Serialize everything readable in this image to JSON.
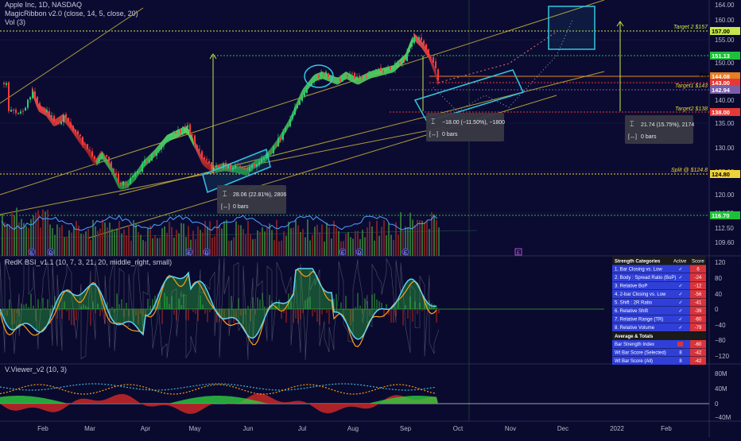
{
  "header": {
    "symbol": "Apple Inc, 1D, NASDAQ",
    "magic_ribbon": "MagicRibbon v2.0 (close, 14, 5, close, 20)",
    "vol": "Vol (3)"
  },
  "panes": {
    "bsi_title": "RedK BSI_v1.1 (10, 7, 3, 21, 20, middle_right, small)",
    "vviewer_title": "V.Viewer_v2 (10, 3)"
  },
  "chart_data": {
    "type": "line",
    "title": "Apple Inc, 1D, NASDAQ",
    "x_ticks": [
      "Feb",
      "Mar",
      "Apr",
      "May",
      "Jun",
      "Jul",
      "Aug",
      "Sep",
      "Oct",
      "Nov",
      "Dec",
      "2022",
      "Feb"
    ],
    "price_axis": [
      "164.00",
      "160.00",
      "155.00",
      "150.00",
      "145.00",
      "140.00",
      "135.00",
      "130.00",
      "125.00",
      "120.00",
      "114.50",
      "112.50",
      "109.60"
    ],
    "price_close_approx": [
      {
        "x": "Jan 26",
        "y": 141
      },
      {
        "x": "Feb 01",
        "y": 136
      },
      {
        "x": "Feb 15",
        "y": 133
      },
      {
        "x": "Mar 01",
        "y": 125
      },
      {
        "x": "Mar 15",
        "y": 121
      },
      {
        "x": "Apr 01",
        "y": 123
      },
      {
        "x": "Apr 15",
        "y": 133
      },
      {
        "x": "May 01",
        "y": 133
      },
      {
        "x": "May 15",
        "y": 126
      },
      {
        "x": "Jun 01",
        "y": 125
      },
      {
        "x": "Jun 15",
        "y": 129
      },
      {
        "x": "Jul 01",
        "y": 137
      },
      {
        "x": "Jul 15",
        "y": 147
      },
      {
        "x": "Aug 01",
        "y": 146
      },
      {
        "x": "Aug 15",
        "y": 148
      },
      {
        "x": "Sep 01",
        "y": 153
      },
      {
        "x": "Sep 07",
        "y": 157
      },
      {
        "x": "Sep 15",
        "y": 148
      },
      {
        "x": "Sep 20",
        "y": 144
      }
    ],
    "price_levels": {
      "target2": {
        "label": "Target 2 $157",
        "tag": "157.00",
        "color": "#c8e64b"
      },
      "resistance": {
        "tag": "151.13",
        "color": "#1fbf3a"
      },
      "pre": {
        "label": "Pre",
        "tag": "144.08",
        "color": "#e67e22"
      },
      "current": {
        "tag": "143.00",
        "color": "#e53935"
      },
      "target1": {
        "label": "Target1 $143",
        "tag": "142.94",
        "color": "#7b5ea7"
      },
      "target2_low": {
        "label": "Target2 $138",
        "tag": "138.00",
        "color": "#e53935"
      },
      "split": {
        "label": "Split @ $124.8",
        "tag": "124.80",
        "color": "#f0d33a"
      },
      "volume_ma": {
        "tag": "116.70",
        "color": "#1fbf3a"
      }
    },
    "measure_labels": [
      {
        "value": "28.06 (22.81%), 2806",
        "bars": "0 bars"
      },
      {
        "value": "−18.00 (−11.50%), −1800",
        "bars": "0 bars"
      },
      {
        "value": "21.74 (15.75%), 2174",
        "bars": "0 bars"
      }
    ],
    "event_markers": [
      "E",
      "D",
      "E",
      "D",
      "E",
      "D",
      "E"
    ],
    "earnings_marker": "E",
    "bsi_axis": [
      "120",
      "80",
      "40",
      "0",
      "−40",
      "−80",
      "−120"
    ],
    "vv_axis": [
      "80M",
      "40M",
      "0",
      "−40M"
    ],
    "strength_table": {
      "header": [
        "Strength Categories",
        "Active",
        "Score"
      ],
      "rows": [
        {
          "name": "1. Bar Closing vs. Low",
          "active": "✓",
          "score": "6"
        },
        {
          "name": "2. Body : Spread Ratio (BoP)",
          "active": "✓",
          "score": "-24"
        },
        {
          "name": "3. Relative BoP",
          "active": "✓",
          "score": "-12"
        },
        {
          "name": "4. 2-bar Closing vs. Low",
          "active": "✓",
          "score": "-56"
        },
        {
          "name": "5. Shift : 2R Ratio",
          "active": "✓",
          "score": "-41"
        },
        {
          "name": "6. Relative Shift",
          "active": "✓",
          "score": "-39"
        },
        {
          "name": "7. Relative Range (TR)",
          "active": "✓",
          "score": "-60"
        },
        {
          "name": "8. Relative Volume",
          "active": "✓",
          "score": "-79"
        }
      ],
      "section": "Average & Totals",
      "totals": [
        {
          "name": "Bar Strength Index",
          "active": "",
          "score": "-60"
        },
        {
          "name": "Wt Bar Score (Selected)",
          "active": "8",
          "score": "-42"
        },
        {
          "name": "Wt Bar Score (All)",
          "active": "8",
          "score": "-42"
        }
      ]
    },
    "colors": {
      "background": "#0a0a2e",
      "ribbon_up": "#2ecc40",
      "ribbon_down": "#e53935",
      "cyan": "#34c6e0",
      "channel": "#c9b63a",
      "table_blue": "#2f3fd8",
      "table_red": "#d8343a"
    }
  }
}
